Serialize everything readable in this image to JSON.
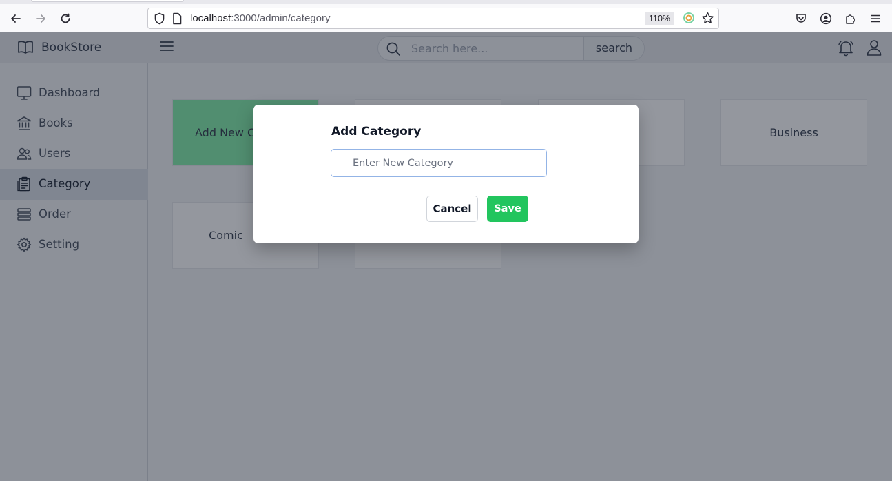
{
  "browser": {
    "url_host": "localhost",
    "url_rest": ":3000/admin/category",
    "zoom": "110%"
  },
  "app": {
    "brand": "BookStore",
    "search_placeholder": "Search here...",
    "search_button": "search"
  },
  "sidebar": {
    "items": [
      {
        "label": "Dashboard",
        "icon": "monitor-icon"
      },
      {
        "label": "Books",
        "icon": "bank-icon"
      },
      {
        "label": "Users",
        "icon": "users-icon"
      },
      {
        "label": "Category",
        "icon": "clipboard-icon",
        "active": true
      },
      {
        "label": "Order",
        "icon": "stack-icon"
      },
      {
        "label": "Setting",
        "icon": "gear-icon"
      }
    ]
  },
  "categories": {
    "add_new": "Add New Category",
    "items": [
      "Business",
      "Comic"
    ]
  },
  "modal": {
    "title": "Add Category",
    "input_placeholder": "Enter New Category",
    "cancel": "Cancel",
    "save": "Save"
  },
  "colors": {
    "accent_green": "#22c55e",
    "add_card_green": "#86efac"
  }
}
